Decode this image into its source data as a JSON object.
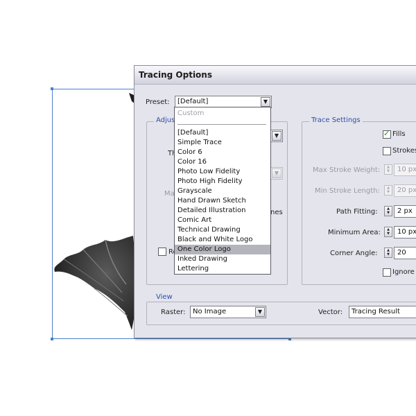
{
  "dialog": {
    "title": "Tracing Options",
    "preset_label": "Preset:",
    "preset_value": "[Default]",
    "adjustments_legend": "Adjus",
    "adjust_threshold_partial": "Th",
    "adjust_max_partial": "Ma",
    "adjust_lines_partial": "nes",
    "adjust_checkbox_partial": "Re",
    "trace_settings": {
      "legend": "Trace Settings",
      "fills_label": "Fills",
      "fills_checked": true,
      "strokes_label": "Strokes",
      "strokes_checked": false,
      "max_stroke_weight_label": "Max Stroke Weight:",
      "max_stroke_weight_value": "10 px",
      "min_stroke_length_label": "Min Stroke Length:",
      "min_stroke_length_value": "20 px",
      "path_fitting_label": "Path Fitting:",
      "path_fitting_value": "2 px",
      "minimum_area_label": "Minimum Area:",
      "minimum_area_value": "10 px",
      "corner_angle_label": "Corner Angle:",
      "corner_angle_value": "20",
      "ignore_label": "Ignore",
      "ignore_checked": false
    },
    "view": {
      "legend": "View",
      "raster_label": "Raster:",
      "raster_value": "No Image",
      "vector_label": "Vector:",
      "vector_value": "Tracing Result"
    }
  },
  "preset_menu": {
    "custom_label": "Custom",
    "items": [
      "[Default]",
      "Simple Trace",
      "Color 6",
      "Color 16",
      "Photo Low Fidelity",
      "Photo High Fidelity",
      "Grayscale",
      "Hand Drawn Sketch",
      "Detailed Illustration",
      "Comic Art",
      "Technical Drawing",
      "Black and White Logo",
      "One Color Logo",
      "Inked Drawing",
      "Lettering"
    ],
    "highlighted_item": "One Color Logo"
  },
  "colors": {
    "dialog_bg": "#e4e4ec",
    "legend_blue": "#2a4fa8",
    "selection_blue": "#4a7fd0",
    "highlight_gray": "#b4b4bc"
  },
  "icons": {
    "dropdown_arrow": "chevron-down-icon",
    "spinner": "spinner-arrows-icon",
    "checkmark": "checkmark-icon"
  }
}
